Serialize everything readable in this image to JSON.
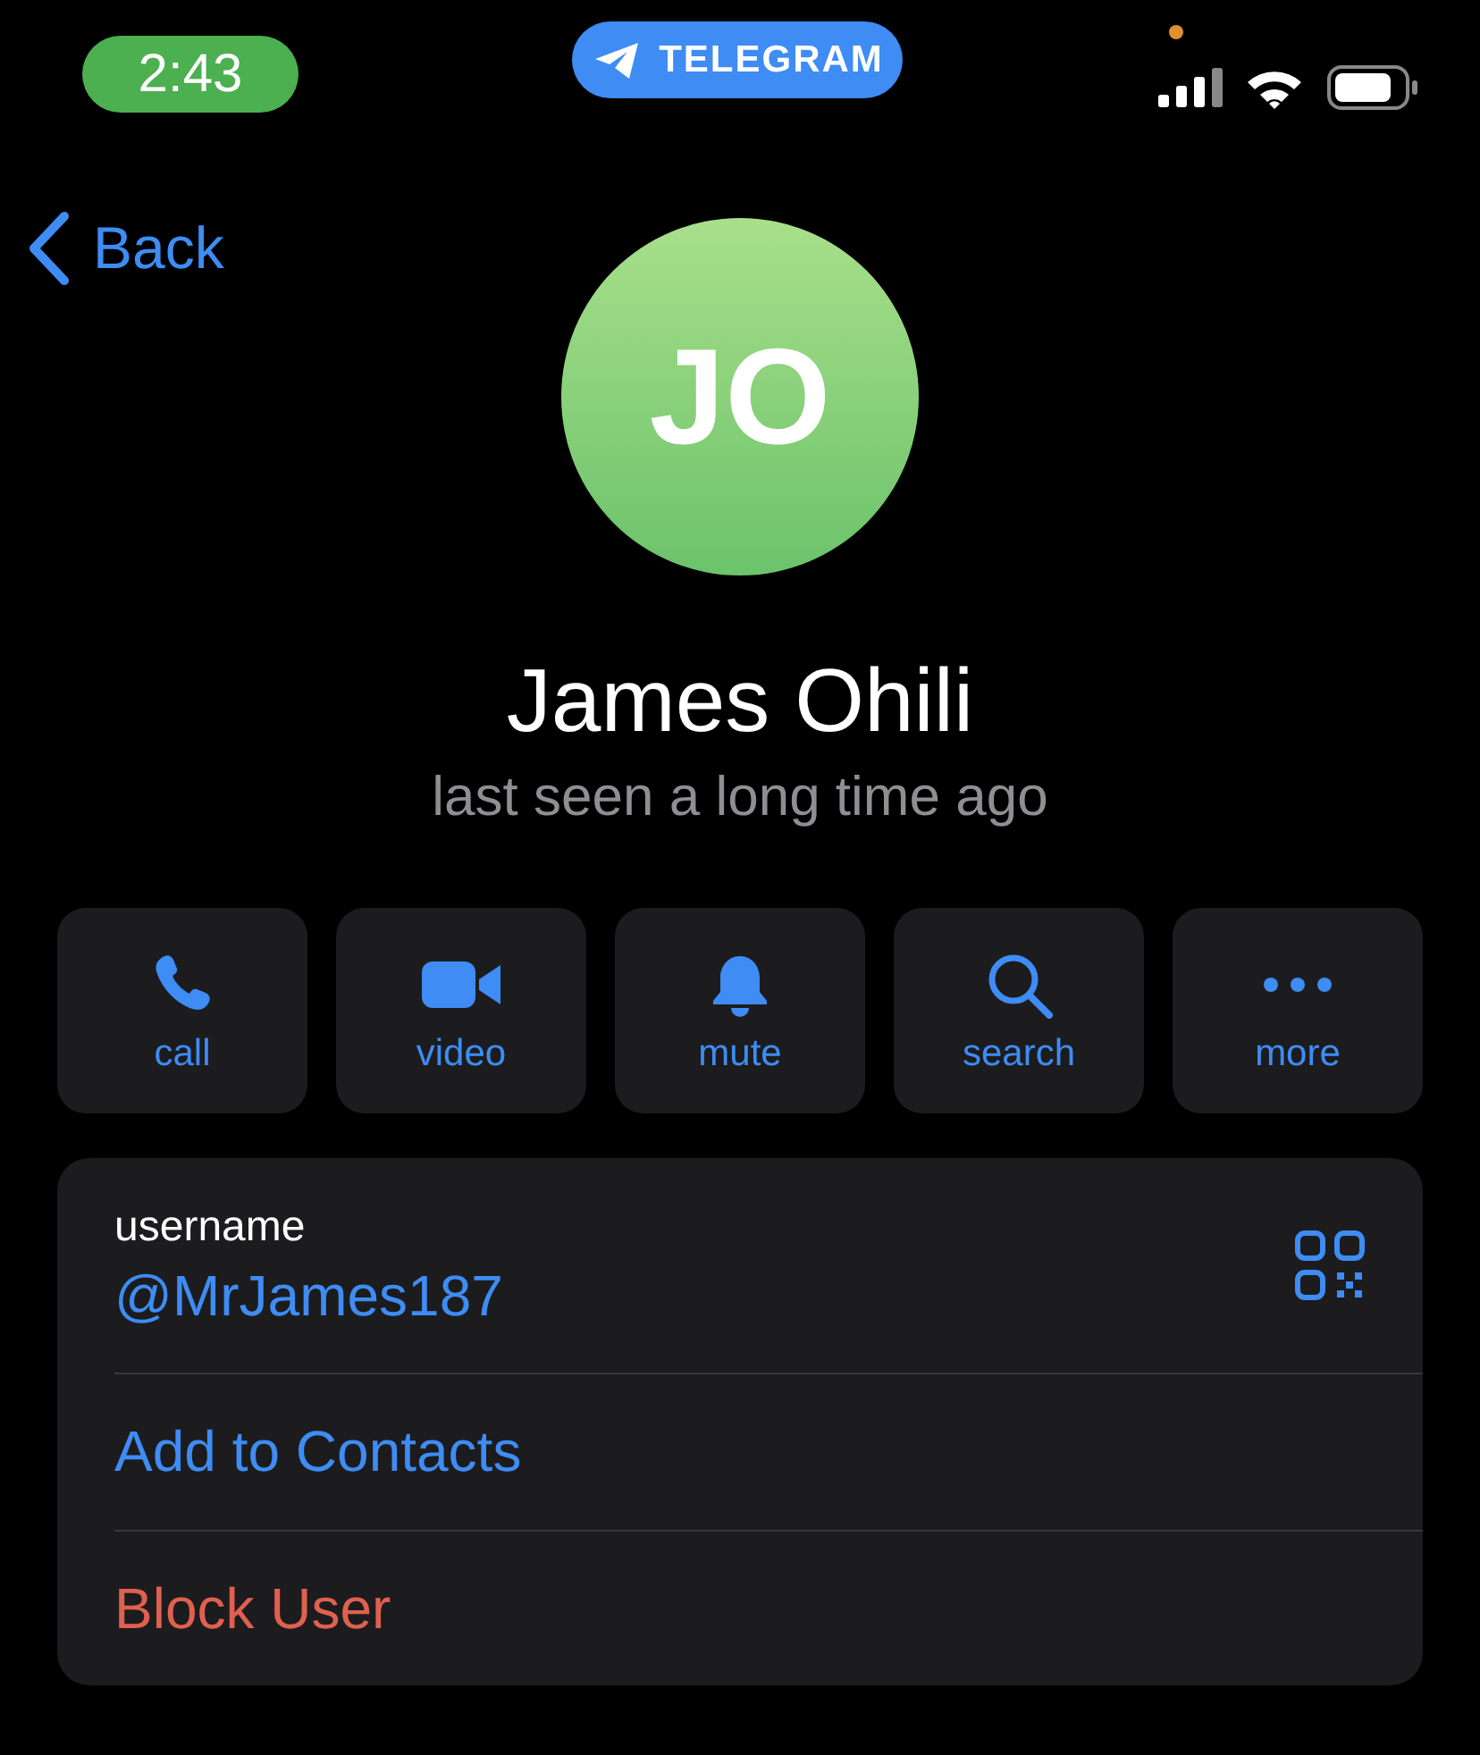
{
  "status_bar": {
    "time": "2:43",
    "app_pill": "TELEGRAM"
  },
  "nav": {
    "back": "Back"
  },
  "profile": {
    "initials": "JO",
    "name": "James Ohili",
    "status": "last seen a long time ago"
  },
  "actions": [
    {
      "kind": "call",
      "label": "call"
    },
    {
      "kind": "video",
      "label": "video"
    },
    {
      "kind": "mute",
      "label": "mute"
    },
    {
      "kind": "search",
      "label": "search"
    },
    {
      "kind": "more",
      "label": "more"
    }
  ],
  "info": {
    "username_label": "username",
    "username": "@MrJames187",
    "rows": [
      {
        "kind": "action",
        "label": "Add to Contacts"
      },
      {
        "kind": "destructive",
        "label": "Block User"
      }
    ]
  }
}
